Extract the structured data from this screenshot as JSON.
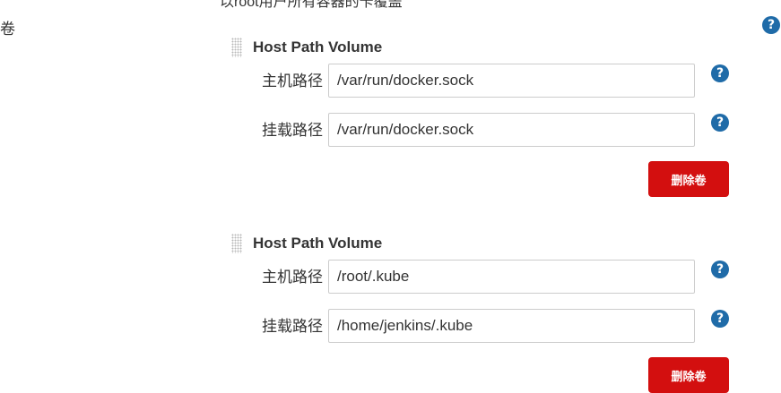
{
  "top_text": "以root用户所有容器的卡覆盖",
  "volumes_section": {
    "label": "卷",
    "help_icon": "question-circle-icon"
  },
  "volumes": [
    {
      "title": "Host Path Volume",
      "host_path_label": "主机路径",
      "host_path_value": "/var/run/docker.sock",
      "mount_path_label": "挂载路径",
      "mount_path_value": "/var/run/docker.sock",
      "delete_label": "删除卷"
    },
    {
      "title": "Host Path Volume",
      "host_path_label": "主机路径",
      "host_path_value": "/root/.kube",
      "mount_path_label": "挂载路径",
      "mount_path_value": "/home/jenkins/.kube",
      "delete_label": "删除卷"
    }
  ],
  "colors": {
    "help_icon": "#1f6ba8",
    "delete_button": "#d30f0f",
    "input_border": "#cccccc",
    "text": "#333333"
  }
}
